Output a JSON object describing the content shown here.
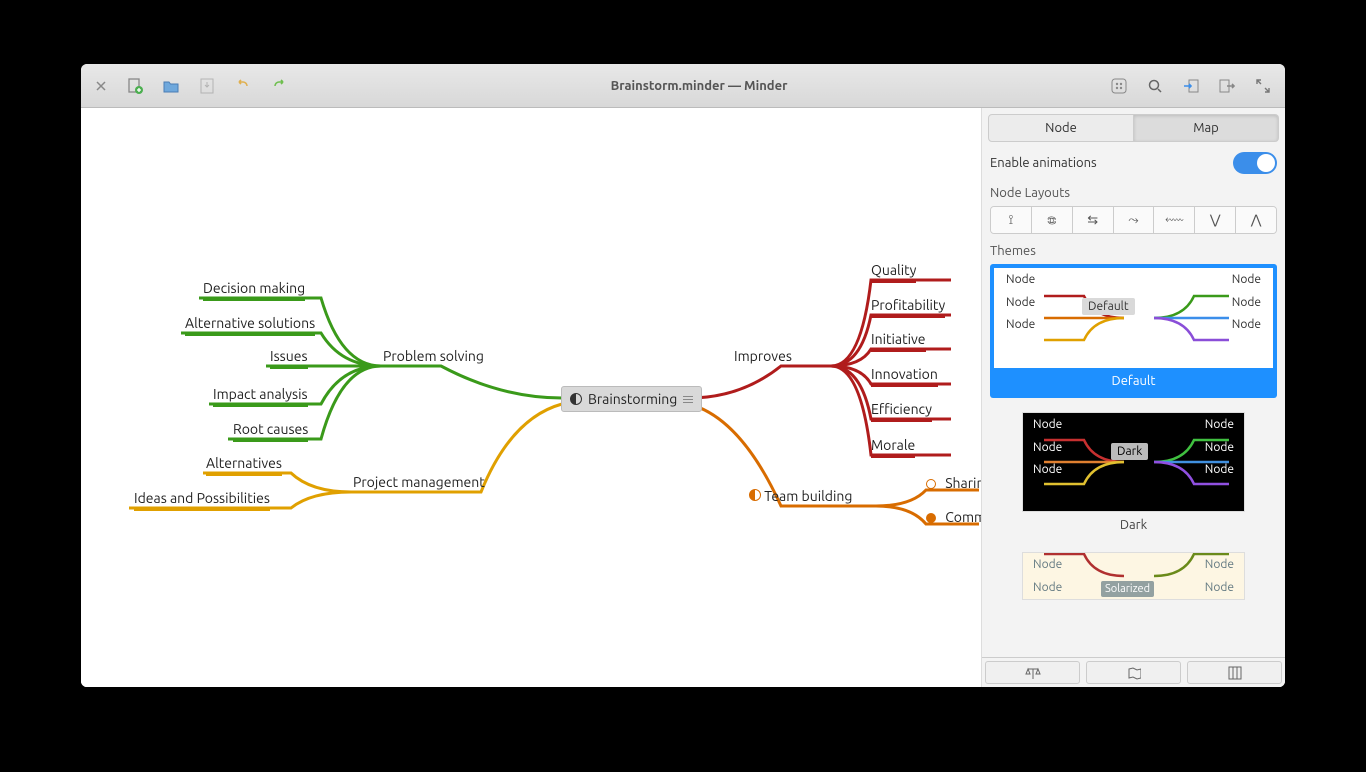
{
  "window": {
    "title": "Brainstorm.minder — Minder"
  },
  "mindmap": {
    "root": "Brainstorming",
    "branches": {
      "problem_solving": {
        "label": "Problem solving",
        "color": "#3a9a1a",
        "children": [
          "Decision making",
          "Alternative solutions",
          "Issues",
          "Impact analysis",
          "Root causes"
        ]
      },
      "project_management": {
        "label": "Project management",
        "color": "#e0a000",
        "children": [
          "Alternatives",
          "Ideas and Possibilities"
        ]
      },
      "improves": {
        "label": "Improves",
        "color": "#b01c1c",
        "children": [
          "Quality",
          "Profitability",
          "Initiative",
          "Innovation",
          "Efficiency",
          "Morale"
        ]
      },
      "team_building": {
        "label": "Team building",
        "color": "#d86c00",
        "children": [
          "Sharing",
          "Communication"
        ]
      }
    }
  },
  "sidebar": {
    "tabs": {
      "node": "Node",
      "map": "Map",
      "active": "Map"
    },
    "enable_animations": "Enable animations",
    "animations_on": true,
    "node_layouts_label": "Node Layouts",
    "themes_label": "Themes",
    "themes": {
      "default": {
        "name": "Default",
        "node_word": "Node"
      },
      "dark": {
        "name": "Dark",
        "node_word": "Node"
      },
      "solarized": {
        "name": "Solarized",
        "node_word": "Node"
      }
    }
  }
}
